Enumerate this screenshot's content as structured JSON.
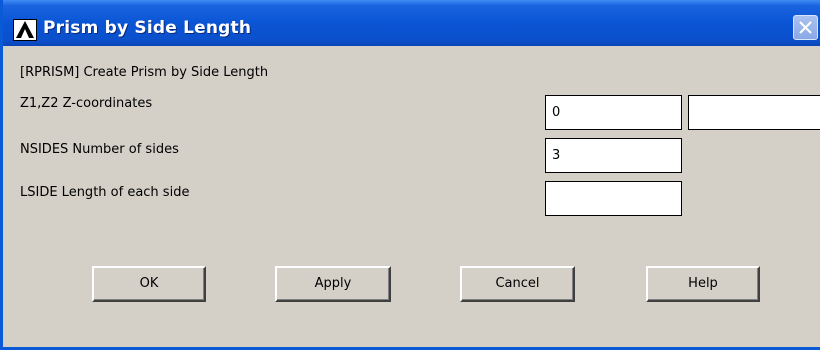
{
  "window": {
    "title": "Prism by Side Length",
    "logo_icon": "ansys-lambda-icon",
    "close_icon": "close-x-icon"
  },
  "form": {
    "command_label": "[RPRISM]  Create Prism by Side Length",
    "fields": [
      {
        "label": "Z1,Z2  Z-coordinates",
        "value1": "0",
        "value2": ""
      },
      {
        "label": "NSIDES  Number of sides",
        "value1": "3"
      },
      {
        "label": "LSIDE   Length of each side",
        "value1": ""
      }
    ]
  },
  "buttons": {
    "ok": "OK",
    "apply": "Apply",
    "cancel": "Cancel",
    "help": "Help"
  },
  "colors": {
    "title_bar": "#0a55d5",
    "dialog_bg": "#d4d0c8"
  }
}
